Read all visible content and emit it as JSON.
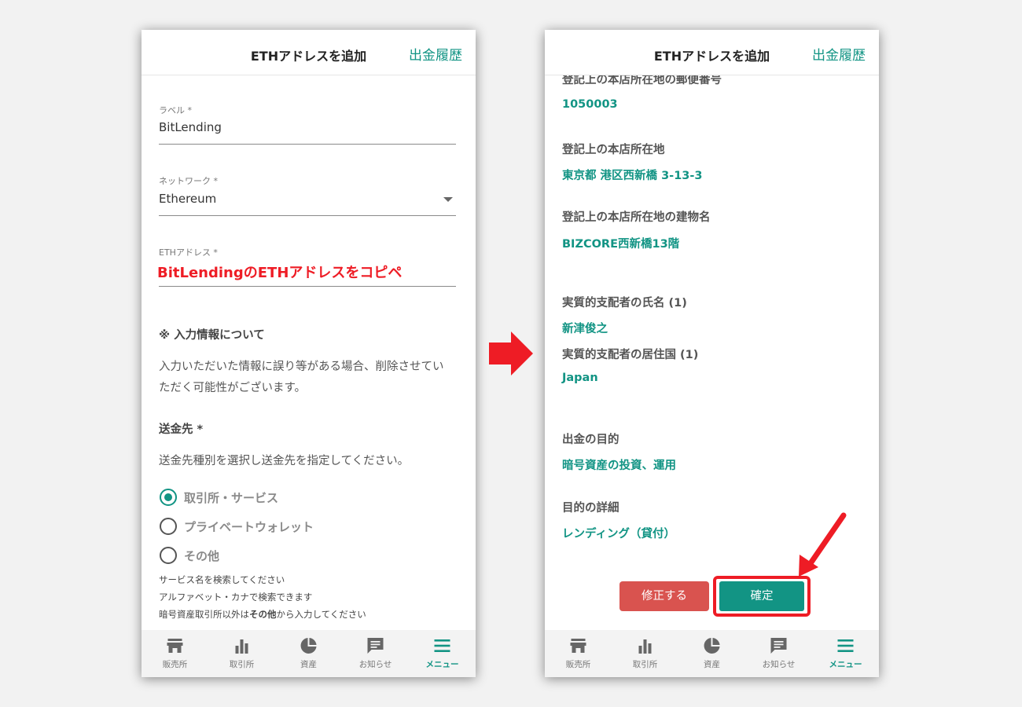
{
  "colors": {
    "accent": "#129484",
    "annotation_red": "#ee1c25",
    "danger": "#d9534f"
  },
  "left": {
    "header": {
      "title": "ETHアドレスを追加",
      "link": "出金履歴"
    },
    "fields": {
      "label": {
        "label": "ラベル *",
        "value": "BitLending"
      },
      "network": {
        "label": "ネットワーク *",
        "value": "Ethereum"
      },
      "address": {
        "label": "ETHアドレス *",
        "annotation": "BitLendingのETHアドレスをコピペ"
      }
    },
    "notice": {
      "title": "※ 入力情報について",
      "line1": "入力いただいた情報に誤り等がある場合、削除させてい",
      "line2": "ただく可能性がございます。"
    },
    "destination": {
      "title": "送金先 *",
      "desc": "送金先種別を選択し送金先を指定してください。",
      "options": [
        "取引所・サービス",
        "プライベートウォレット",
        "その他"
      ],
      "selected": "取引所・サービス",
      "hint1": "サービス名を検索してください",
      "hint2": "アルファベット・カナで検索できます",
      "hint3_pre": "暗号資産取引所以外は",
      "hint3_bold": "その他",
      "hint3_post": "から入力してください"
    }
  },
  "right": {
    "header": {
      "title": "ETHアドレスを追加",
      "link": "出金履歴"
    },
    "rows": [
      {
        "label": "登記上の本店所在地の郵便番号",
        "value": "1050003"
      },
      {
        "label": "登記上の本店所在地",
        "value": "東京都 港区西新橋 3-13-3"
      },
      {
        "label": "登記上の本店所在地の建物名",
        "value": "BIZCORE西新橋13階"
      },
      {
        "label": "実質的支配者の氏名 (1)",
        "value": "新津俊之"
      },
      {
        "label": "実質的支配者の居住国 (1)",
        "value": "Japan"
      },
      {
        "label": "出金の目的",
        "value": "暗号資産の投資、運用"
      },
      {
        "label": "目的の詳細",
        "value": "レンディング（貸付）"
      }
    ],
    "buttons": {
      "fix": "修正する",
      "confirm": "確定"
    }
  },
  "nav": [
    {
      "label": "販売所",
      "icon": "store-icon"
    },
    {
      "label": "取引所",
      "icon": "bar-chart-icon"
    },
    {
      "label": "資産",
      "icon": "pie-chart-icon"
    },
    {
      "label": "お知らせ",
      "icon": "message-icon"
    },
    {
      "label": "メニュー",
      "icon": "menu-icon",
      "active": true
    }
  ]
}
